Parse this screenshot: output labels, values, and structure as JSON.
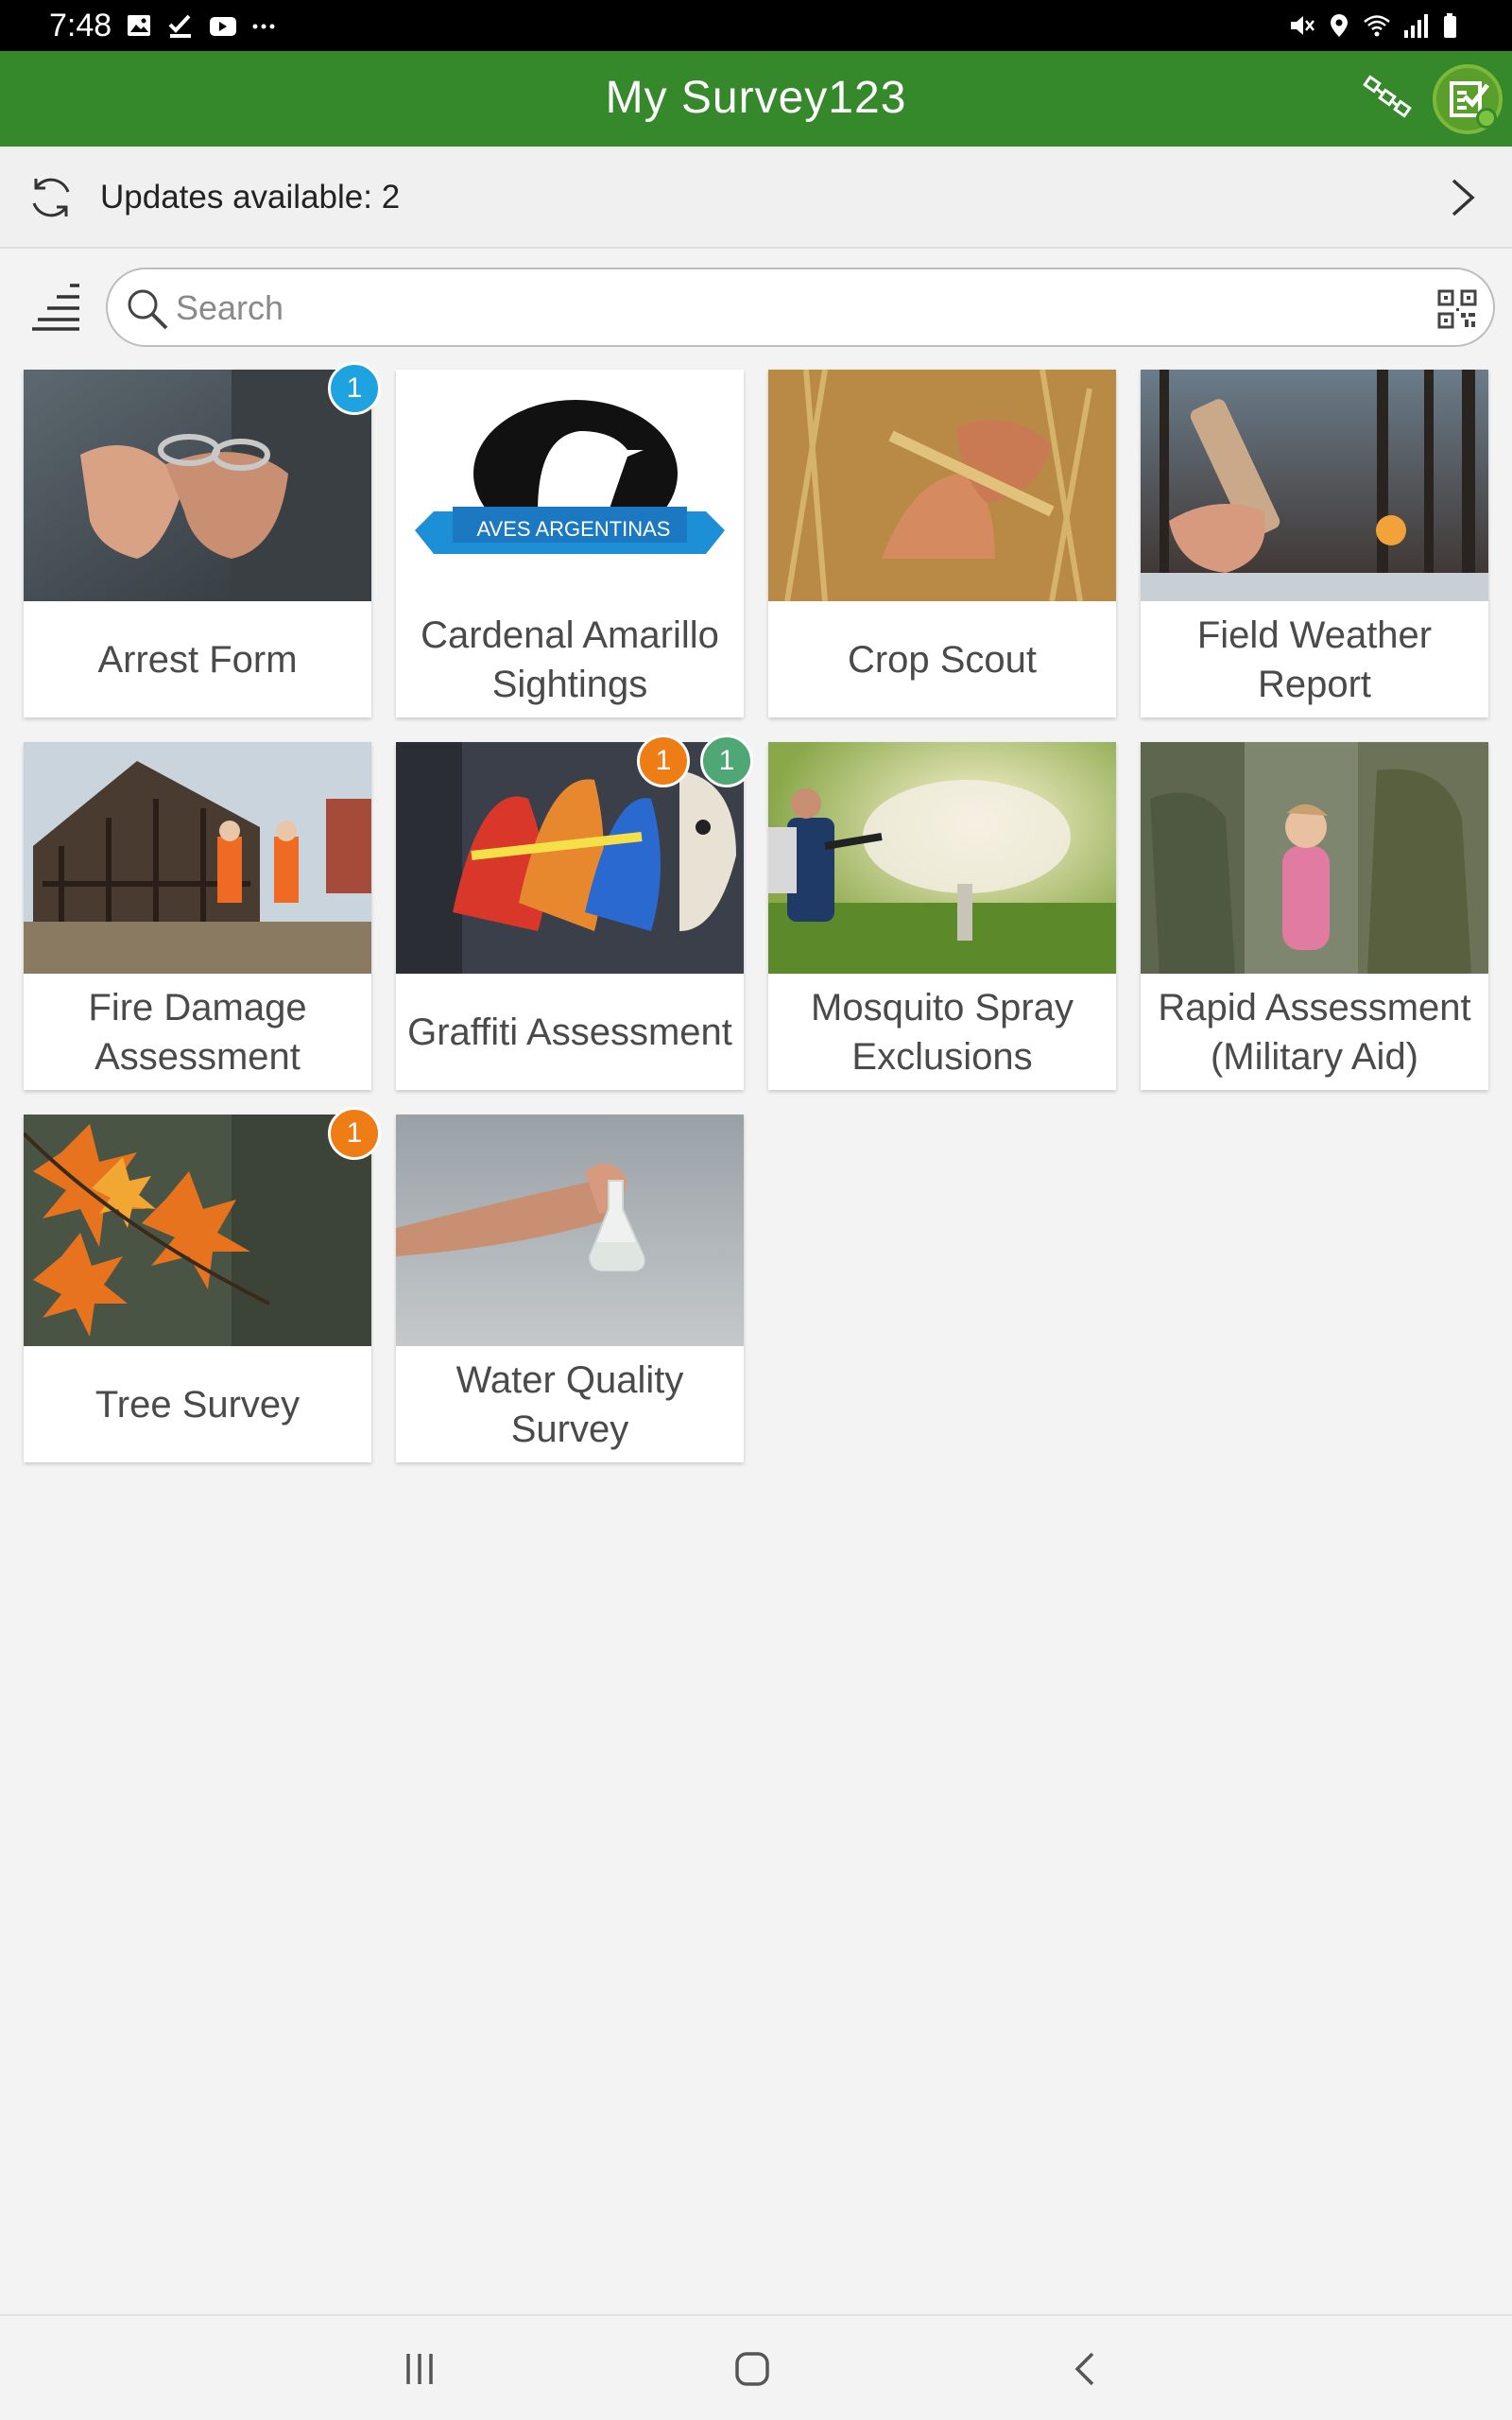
{
  "status_bar": {
    "time": "7:48"
  },
  "header": {
    "title": "My Survey123"
  },
  "updates": {
    "text": "Updates available: 2"
  },
  "search": {
    "placeholder": "Search",
    "value": ""
  },
  "surveys": [
    {
      "title": "Arrest Form",
      "badges": [
        "1"
      ]
    },
    {
      "title": "Cardenal Amarillo Sightings",
      "logo_text": "AVES ARGENTINAS",
      "badges": []
    },
    {
      "title": "Crop Scout",
      "badges": []
    },
    {
      "title": "Field Weather Report",
      "badges": []
    },
    {
      "title": "Fire Damage Assessment",
      "badges": []
    },
    {
      "title": "Graffiti Assessment",
      "badges": [
        "1",
        "1"
      ]
    },
    {
      "title": "Mosquito Spray Exclusions",
      "badges": []
    },
    {
      "title": "Rapid Assessment (Military Aid)",
      "badges": []
    },
    {
      "title": "Tree Survey",
      "badges": [
        "1"
      ]
    },
    {
      "title": "Water Quality Survey",
      "badges": []
    }
  ],
  "colors": {
    "header_green": "#35892b",
    "badge_blue": "#1fa2e0",
    "badge_orange": "#ef7d15",
    "badge_green": "#4ea774"
  },
  "icons": [
    "image-icon",
    "task-icon",
    "youtube-icon",
    "more-icon",
    "mute-icon",
    "location-icon",
    "wifi-icon",
    "signal-icon",
    "battery-icon",
    "satellite-icon",
    "profile-icon",
    "sync-icon",
    "chevron-right-icon",
    "menu-icon",
    "search-icon",
    "qr-code-icon",
    "recent-apps-icon",
    "home-icon",
    "back-icon"
  ]
}
